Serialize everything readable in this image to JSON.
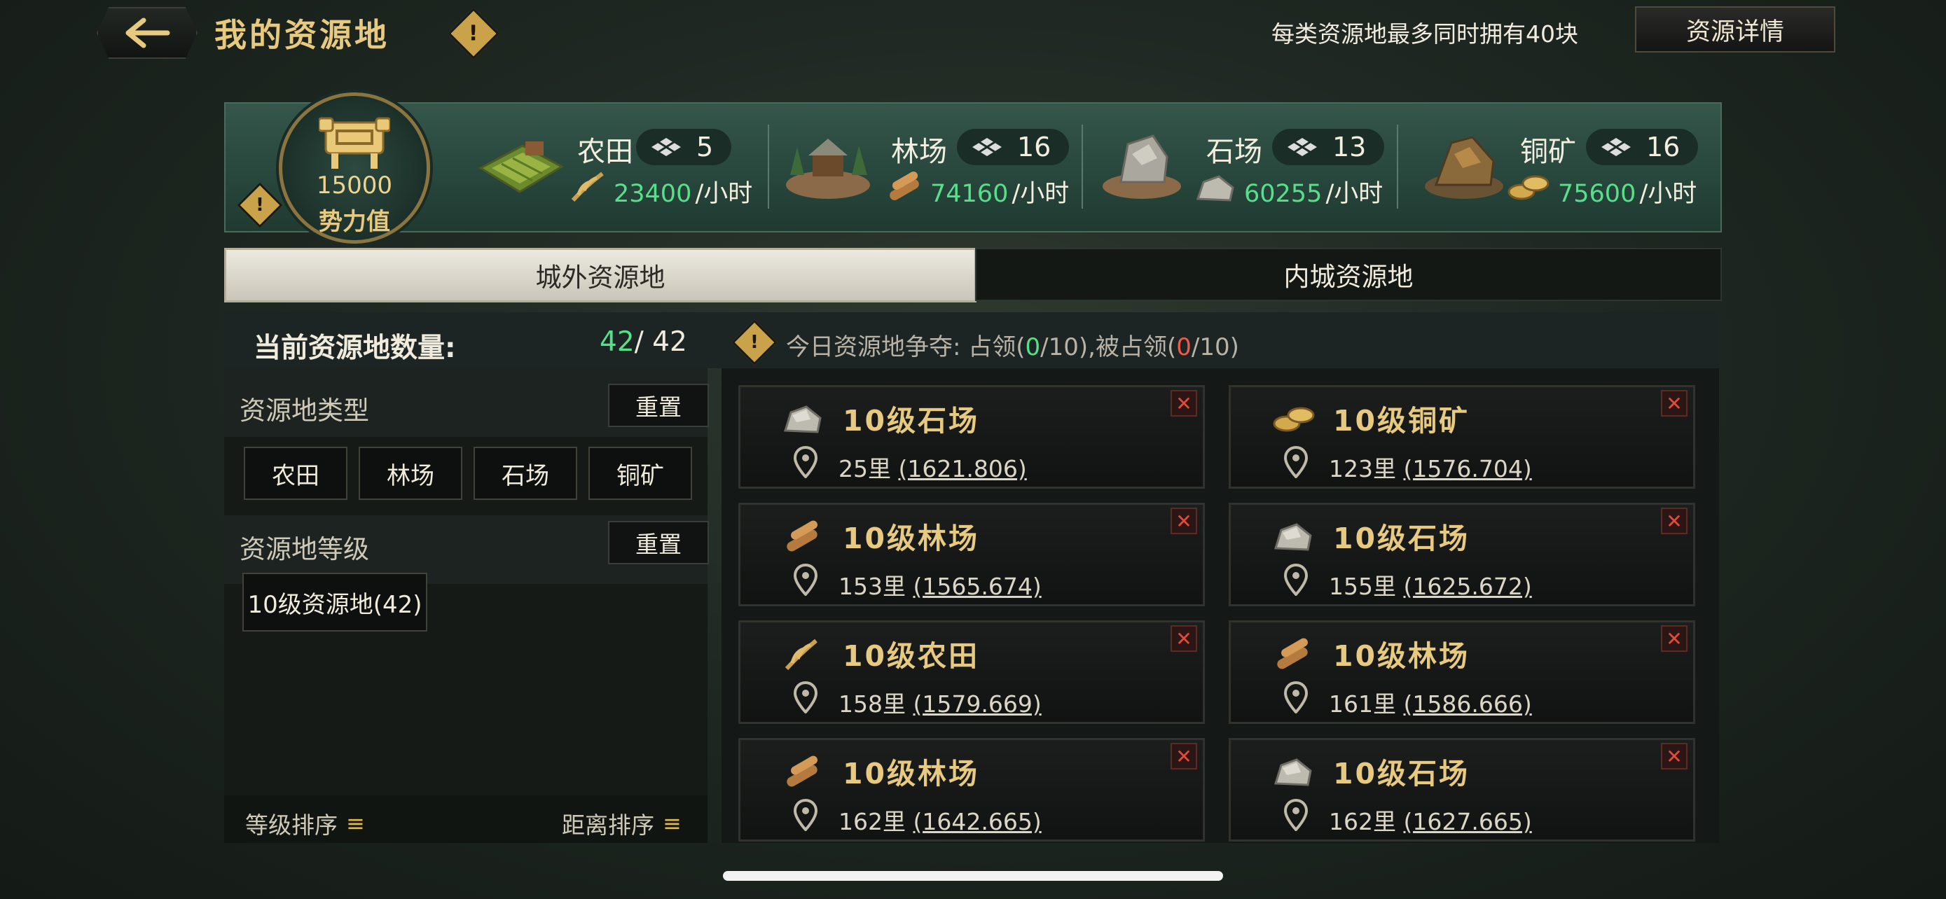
{
  "header": {
    "title": "我的资源地",
    "hint": "每类资源地最多同时拥有40块",
    "detail_button": "资源详情"
  },
  "power": {
    "value": "15000",
    "label": "势力值"
  },
  "resources": [
    {
      "name": "农田",
      "count": "5",
      "rate": "23400",
      "unit": "/小时",
      "icon": "farmland-icon"
    },
    {
      "name": "林场",
      "count": "16",
      "rate": "74160",
      "unit": "/小时",
      "icon": "lumber-icon"
    },
    {
      "name": "石场",
      "count": "13",
      "rate": "60255",
      "unit": "/小时",
      "icon": "stone-icon"
    },
    {
      "name": "铜矿",
      "count": "16",
      "rate": "75600",
      "unit": "/小时",
      "icon": "copper-icon"
    }
  ],
  "tabs": {
    "outer": "城外资源地",
    "inner": "内城资源地"
  },
  "summary": {
    "label": "当前资源地数量:",
    "current": "42",
    "total": "/ 42",
    "daily_prefix": "今日资源地争夺: 占领(",
    "occupied": "0",
    "occupied_max": "/10),被占领(",
    "lost": "0",
    "lost_max": "/10)"
  },
  "filters": {
    "type_title": "资源地类型",
    "reset": "重置",
    "types": [
      "农田",
      "林场",
      "石场",
      "铜矿"
    ],
    "level_title": "资源地等级",
    "levels": [
      "10级资源地(42)"
    ],
    "sort_level": "等级排序",
    "sort_distance": "距离排序"
  },
  "cards": [
    {
      "title": "10级石场",
      "distance": "25里",
      "coords": "(1621.806)",
      "icon": "stone-icon"
    },
    {
      "title": "10级铜矿",
      "distance": "123里",
      "coords": "(1576.704)",
      "icon": "copper-icon"
    },
    {
      "title": "10级林场",
      "distance": "153里",
      "coords": "(1565.674)",
      "icon": "lumber-icon"
    },
    {
      "title": "10级石场",
      "distance": "155里",
      "coords": "(1625.672)",
      "icon": "stone-icon"
    },
    {
      "title": "10级农田",
      "distance": "158里",
      "coords": "(1579.669)",
      "icon": "wheat-icon"
    },
    {
      "title": "10级林场",
      "distance": "161里",
      "coords": "(1586.666)",
      "icon": "lumber-icon"
    },
    {
      "title": "10级林场",
      "distance": "162里",
      "coords": "(1642.665)",
      "icon": "lumber-icon"
    },
    {
      "title": "10级石场",
      "distance": "162里",
      "coords": "(1627.665)",
      "icon": "stone-icon"
    }
  ],
  "colors": {
    "gold": "#e7c980",
    "green": "#57e08a",
    "red": "#ef5a4b"
  }
}
